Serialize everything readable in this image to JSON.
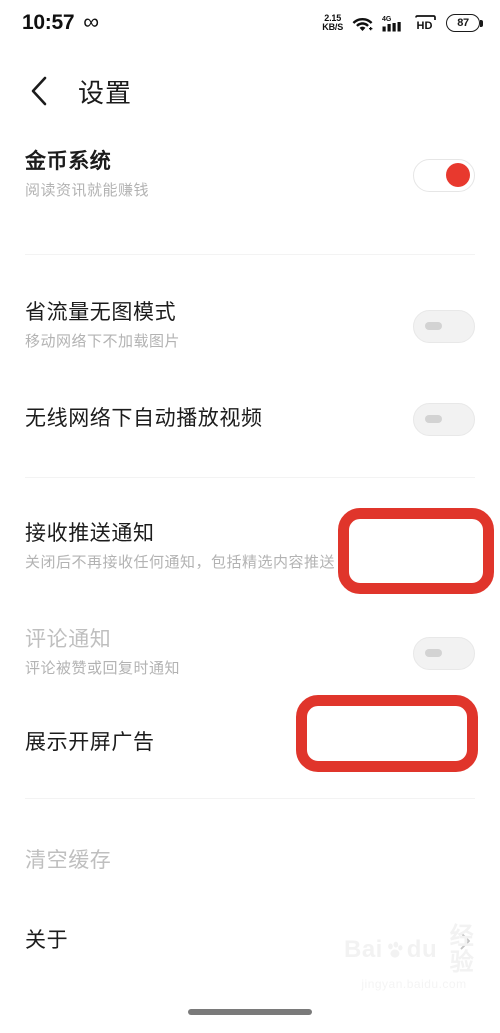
{
  "status_bar": {
    "time": "10:57",
    "infinity_icon": "infinity-icon",
    "network_speed_value": "2.15",
    "network_speed_unit": "KB/S",
    "wifi_icon": "wifi-icon",
    "signal_label": "4G",
    "signal_icon": "cellular-signal-icon",
    "hd_label": "HD",
    "battery_level": "87"
  },
  "header": {
    "back_icon": "chevron-left-icon",
    "title": "设置"
  },
  "settings": {
    "rows": [
      {
        "title": "金币系统",
        "subtitle": "阅读资讯就能赚钱",
        "control": "toggle",
        "state": "on",
        "disabled": false
      },
      {
        "title": "省流量无图模式",
        "subtitle": "移动网络下不加载图片",
        "control": "toggle",
        "state": "off",
        "disabled": false
      },
      {
        "title": "无线网络下自动播放视频",
        "subtitle": "",
        "control": "toggle",
        "state": "off",
        "disabled": false
      },
      {
        "title": "接收推送通知",
        "subtitle": "关闭后不再接收任何通知，包括精选内容推送",
        "control": "toggle",
        "state": "off",
        "disabled": false
      },
      {
        "title": "评论通知",
        "subtitle": "评论被赞或回复时通知",
        "control": "toggle",
        "state": "off",
        "disabled": true
      },
      {
        "title": "展示开屏广告",
        "subtitle": "",
        "control": "toggle",
        "state": "off",
        "disabled": false
      },
      {
        "title": "清空缓存",
        "subtitle": "",
        "control": "none",
        "state": "",
        "disabled": true
      },
      {
        "title": "关于",
        "subtitle": "",
        "control": "chevron",
        "state": "",
        "disabled": false
      }
    ]
  },
  "annotations": {
    "color": "#e0352b",
    "boxes": [
      {
        "target": "接收推送通知",
        "name": "push-notification-toggle-highlight"
      },
      {
        "target": "展示开屏广告",
        "name": "splash-ad-toggle-highlight"
      }
    ]
  },
  "watermark": {
    "brand_prefix": "Bai",
    "brand_suffix": "du",
    "brand_cn": "经验",
    "url": "jingyan.baidu.com"
  },
  "home_indicator": "home-indicator-bar"
}
